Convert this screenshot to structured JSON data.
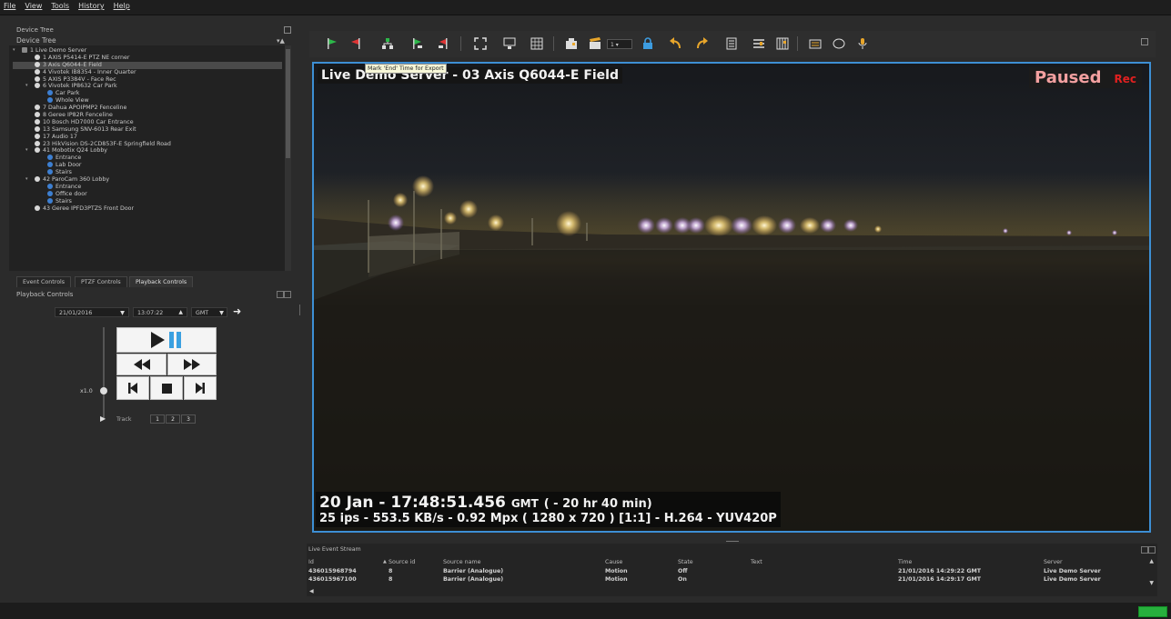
{
  "menu": [
    "File",
    "View",
    "Tools",
    "History",
    "Help"
  ],
  "left_panel": {
    "device_tree_header": "Device Tree",
    "device_tree_label": "Device Tree",
    "tree": [
      {
        "label": "1 Live Demo Server",
        "level": 0,
        "icon": "server-icon"
      },
      {
        "label": "1 AXIS P5414-E PTZ NE corner",
        "level": 1,
        "icon": "camera-icon"
      },
      {
        "label": "3 Axis Q6044-E Field",
        "level": 1,
        "icon": "camera-icon",
        "selected": true
      },
      {
        "label": "4 Vivotek IB8354 - Inner Quarter",
        "level": 1,
        "icon": "camera-icon"
      },
      {
        "label": "5 AXIS P3384V - Face Rec",
        "level": 1,
        "icon": "camera-icon"
      },
      {
        "label": "6 Vivotek IP8632 Car Park",
        "level": 1,
        "icon": "camera-icon"
      },
      {
        "label": "Car Park",
        "level": 2,
        "icon": "view-icon"
      },
      {
        "label": "Whole View",
        "level": 2,
        "icon": "view-icon"
      },
      {
        "label": "7 Dahua APOIPMP2 Fenceline",
        "level": 1,
        "icon": "camera-icon"
      },
      {
        "label": "8 Geree IP82R Fenceline",
        "level": 1,
        "icon": "camera-icon"
      },
      {
        "label": "10 Bosch HD7000 Car Entrance",
        "level": 1,
        "icon": "camera-icon"
      },
      {
        "label": "13 Samsung SNV-6013 Rear Exit",
        "level": 1,
        "icon": "camera-icon"
      },
      {
        "label": "17 Audio 17",
        "level": 1,
        "icon": "camera-icon"
      },
      {
        "label": "23 HikVision DS-2CD853F-E Springfield Road",
        "level": 1,
        "icon": "camera-icon"
      },
      {
        "label": "41 Mobotix Q24 Lobby",
        "level": 1,
        "icon": "camera-icon"
      },
      {
        "label": "Entrance",
        "level": 2,
        "icon": "view-icon"
      },
      {
        "label": "Lab Door",
        "level": 2,
        "icon": "view-icon"
      },
      {
        "label": "Stairs",
        "level": 2,
        "icon": "view-icon"
      },
      {
        "label": "42 ParoCam 360 Lobby",
        "level": 1,
        "icon": "camera-icon"
      },
      {
        "label": "Entrance",
        "level": 2,
        "icon": "view-icon"
      },
      {
        "label": "Office door",
        "level": 2,
        "icon": "view-icon"
      },
      {
        "label": "Stairs",
        "level": 2,
        "icon": "view-icon"
      },
      {
        "label": "43 Geree IPFD3PTZS Front Door",
        "level": 1,
        "icon": "camera-icon"
      }
    ],
    "tabs": [
      "Event Controls",
      "PTZF Controls",
      "Playback Controls"
    ],
    "playback_title": "Playback Controls",
    "date": "21/01/2016",
    "time": "13:07:22",
    "tz": "GMT",
    "speed": "x1.0",
    "track_label": "Track",
    "tracks": [
      "1",
      "2",
      "3"
    ]
  },
  "tooltip": "Mark 'End' Time for Export",
  "video": {
    "title": "Live Demo Server - 03 Axis Q6044-E Field",
    "paused": "Paused",
    "rec": "Rec",
    "time_main": "20 Jan - 17:48:51.456",
    "time_tz": "GMT",
    "time_offset": "( - 20 hr 40 min)",
    "stats": "25 ips  -  553.5 KB/s  -  0.92 Mpx  ( 1280 x 720 ) [1:1] -  H.264  -  YUV420P"
  },
  "events": {
    "title": "Live Event Stream",
    "columns": [
      "Id",
      "Source id",
      "Source name",
      "Cause",
      "State",
      "Text",
      "Time",
      "Server"
    ],
    "rows": [
      [
        "436015968794",
        "8",
        "Barrier (Analogue)",
        "Motion",
        "Off",
        "",
        "21/01/2016 14:29:22 GMT",
        "Live Demo Server"
      ],
      [
        "436015967100",
        "8",
        "Barrier (Analogue)",
        "Motion",
        "On",
        "",
        "21/01/2016 14:29:17 GMT",
        "Live Demo Server"
      ]
    ]
  },
  "colors": {
    "accent": "#3d8fd4",
    "rec": "#e02020",
    "paused": "#f3a0a0",
    "status_ok": "#27b03d"
  }
}
